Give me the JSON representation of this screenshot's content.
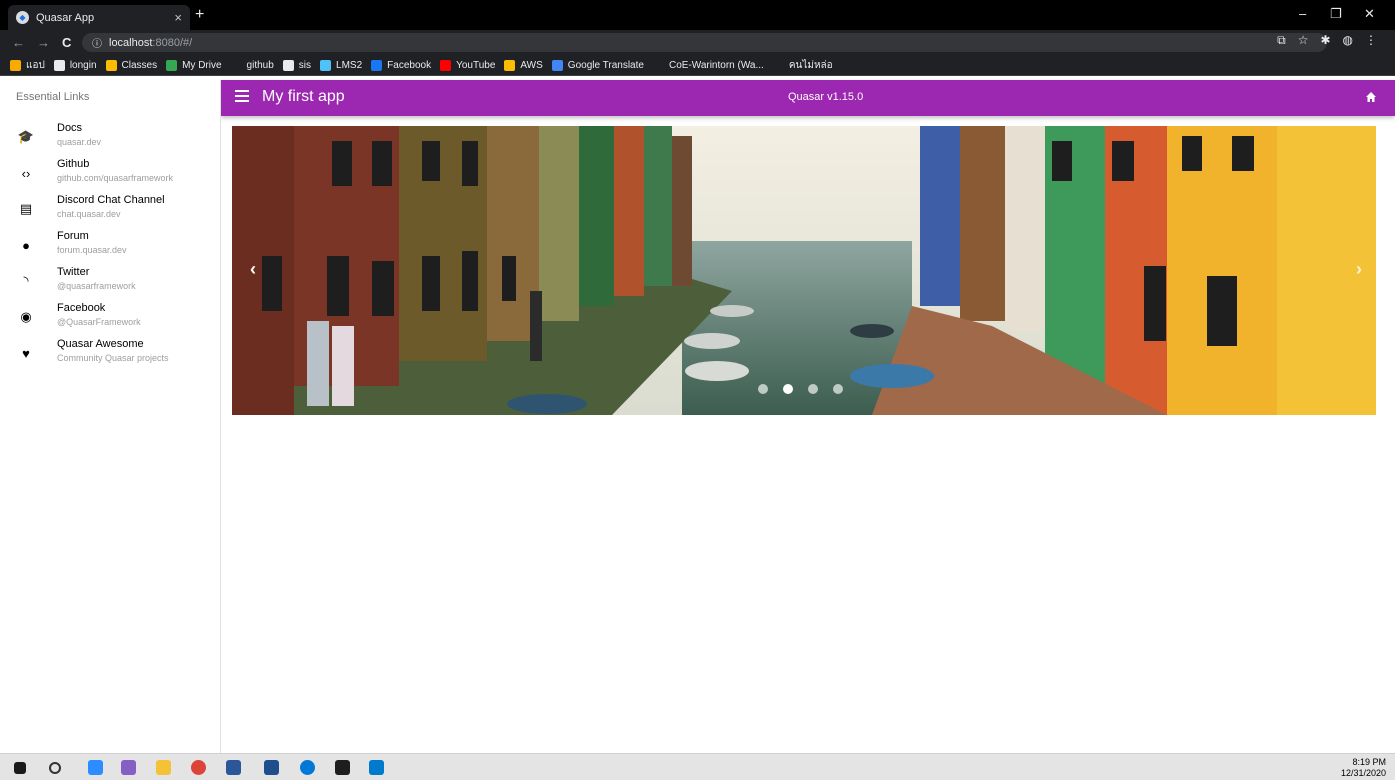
{
  "browser": {
    "tab_title": "Quasar App",
    "tab_close": "×",
    "new_tab": "+",
    "url_host": "localhost",
    "url_rest": ":8080/#/",
    "window_controls": [
      "–",
      "❐",
      "✕"
    ],
    "bookmarks": [
      {
        "label": "แอป",
        "color": "#f9ab00"
      },
      {
        "label": "longin",
        "color": "#e8eaed"
      },
      {
        "label": "Classes",
        "color": "#fbbc04"
      },
      {
        "label": "My Drive",
        "color": "#34a853"
      },
      {
        "label": "github",
        "color": "#202124"
      },
      {
        "label": "sis",
        "color": "#e8eaed"
      },
      {
        "label": "LMS2",
        "color": "#4fc3f7"
      },
      {
        "label": "Facebook",
        "color": "#1877f2"
      },
      {
        "label": "YouTube",
        "color": "#ff0000"
      },
      {
        "label": "AWS",
        "color": "#fbbc04"
      },
      {
        "label": "Google Translate",
        "color": "#4285f4"
      },
      {
        "label": "CoE-Warintorn (Wa...",
        "color": "#202124"
      },
      {
        "label": "คนไม่หล่อ",
        "color": "#202124"
      }
    ]
  },
  "drawer": {
    "title": "Essential Links",
    "links": [
      {
        "title": "Docs",
        "caption": "quasar.dev",
        "icon": "school-icon",
        "glyph": "🎓"
      },
      {
        "title": "Github",
        "caption": "github.com/quasarframework",
        "icon": "code-icon",
        "glyph": "‹›"
      },
      {
        "title": "Discord Chat Channel",
        "caption": "chat.quasar.dev",
        "icon": "chat-icon",
        "glyph": "▤"
      },
      {
        "title": "Forum",
        "caption": "forum.quasar.dev",
        "icon": "record-voice-icon",
        "glyph": "●"
      },
      {
        "title": "Twitter",
        "caption": "@quasarframework",
        "icon": "rss-feed-icon",
        "glyph": "◝"
      },
      {
        "title": "Facebook",
        "caption": "@QuasarFramework",
        "icon": "public-icon",
        "glyph": "◉"
      },
      {
        "title": "Quasar Awesome",
        "caption": "Community Quasar projects",
        "icon": "favorite-icon",
        "glyph": "♥"
      }
    ]
  },
  "header": {
    "title": "My first app",
    "version": "Quasar v1.15.0",
    "color": "#9c27b0"
  },
  "carousel": {
    "prev": "‹",
    "next": "›",
    "slide_count": 4,
    "active_slide": 2
  },
  "taskbar": {
    "time": "8:19 PM",
    "date": "12/31/2020"
  }
}
